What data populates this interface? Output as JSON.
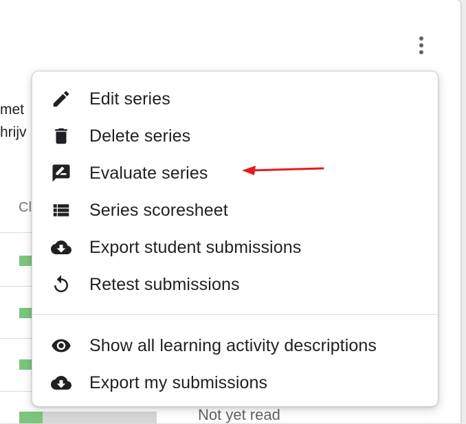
{
  "background": {
    "line1_fragment": "met",
    "line2_fragment": "hrijv",
    "column_header_fragment": "Cl",
    "status_text": "Not yet read"
  },
  "menu": {
    "items": [
      {
        "label": "Edit series",
        "icon": "pencil-icon"
      },
      {
        "label": "Delete series",
        "icon": "trash-icon"
      },
      {
        "label": "Evaluate series",
        "icon": "rate-review-icon"
      },
      {
        "label": "Series scoresheet",
        "icon": "list-icon"
      },
      {
        "label": "Export student submissions",
        "icon": "cloud-download-icon"
      },
      {
        "label": "Retest submissions",
        "icon": "refresh-icon"
      },
      {
        "label": "Show all learning activity descriptions",
        "icon": "eye-icon"
      },
      {
        "label": "Export my submissions",
        "icon": "cloud-download-icon"
      }
    ]
  },
  "annotation": {
    "color": "#e31b1b"
  },
  "colors": {
    "progress": "#7cc57e",
    "text": "#202124",
    "muted": "#5f6368"
  }
}
